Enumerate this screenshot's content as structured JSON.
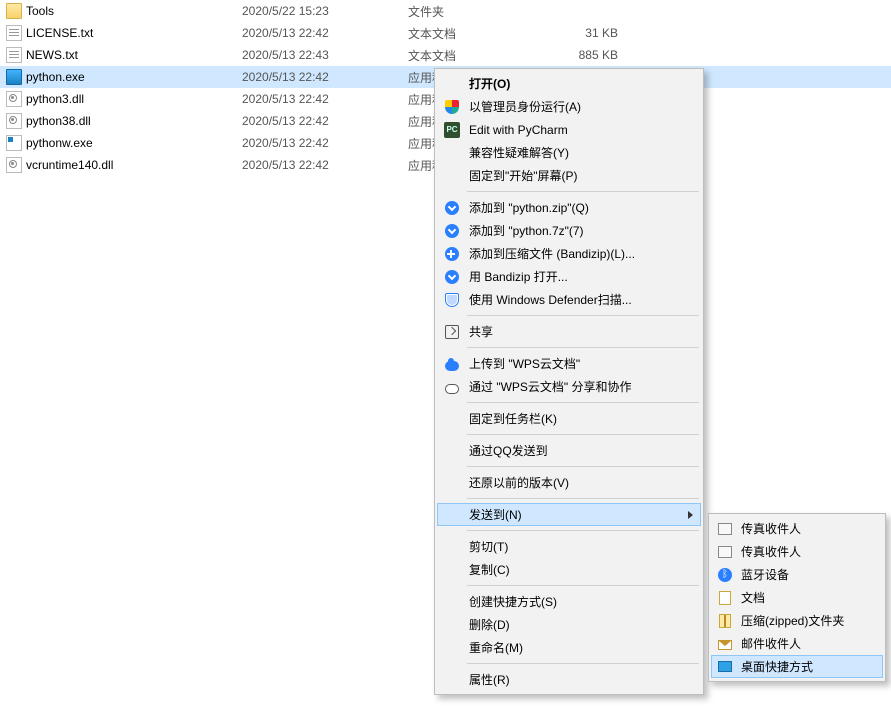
{
  "files": [
    {
      "icon": "folder",
      "name": "Tools",
      "date": "2020/5/22 15:23",
      "type": "文件夹",
      "size": ""
    },
    {
      "icon": "txt",
      "name": "LICENSE.txt",
      "date": "2020/5/13 22:42",
      "type": "文本文档",
      "size": "31 KB"
    },
    {
      "icon": "txt",
      "name": "NEWS.txt",
      "date": "2020/5/13 22:43",
      "type": "文本文档",
      "size": "885 KB"
    },
    {
      "icon": "exe",
      "name": "python.exe",
      "date": "2020/5/13 22:42",
      "type": "应用程序",
      "size": "",
      "selected": true
    },
    {
      "icon": "dll",
      "name": "python3.dll",
      "date": "2020/5/13 22:42",
      "type": "应用程序扩展",
      "size": ""
    },
    {
      "icon": "dll",
      "name": "python38.dll",
      "date": "2020/5/13 22:42",
      "type": "应用程序扩展",
      "size": ""
    },
    {
      "icon": "exe2",
      "name": "pythonw.exe",
      "date": "2020/5/13 22:42",
      "type": "应用程序",
      "size": ""
    },
    {
      "icon": "dll",
      "name": "vcruntime140.dll",
      "date": "2020/5/13 22:42",
      "type": "应用程序扩展",
      "size": ""
    }
  ],
  "menu": {
    "open": "打开(O)",
    "admin": "以管理员身份运行(A)",
    "pycharm": "Edit with PyCharm",
    "compat": "兼容性疑难解答(Y)",
    "pinstart": "固定到\"开始\"屏幕(P)",
    "zipq": "添加到 \"python.zip\"(Q)",
    "z7": "添加到 \"python.7z\"(7)",
    "bandil": "添加到压缩文件 (Bandizip)(L)...",
    "bandiopen": "用 Bandizip 打开...",
    "defender": "使用 Windows Defender扫描...",
    "share": "共享",
    "wpsup": "上传到 \"WPS云文档\"",
    "wpsshare": "通过 \"WPS云文档\" 分享和协作",
    "pintask": "固定到任务栏(K)",
    "qq": "通过QQ发送到",
    "restore": "还原以前的版本(V)",
    "sendto": "发送到(N)",
    "cut": "剪切(T)",
    "copy": "复制(C)",
    "shortcut": "创建快捷方式(S)",
    "delete": "删除(D)",
    "rename": "重命名(M)",
    "prop": "属性(R)"
  },
  "submenu": {
    "fax1": "传真收件人",
    "fax2": "传真收件人",
    "bt": "蓝牙设备",
    "docs": "文档",
    "zip": "压缩(zipped)文件夹",
    "mail": "邮件收件人",
    "desktop": "桌面快捷方式"
  }
}
